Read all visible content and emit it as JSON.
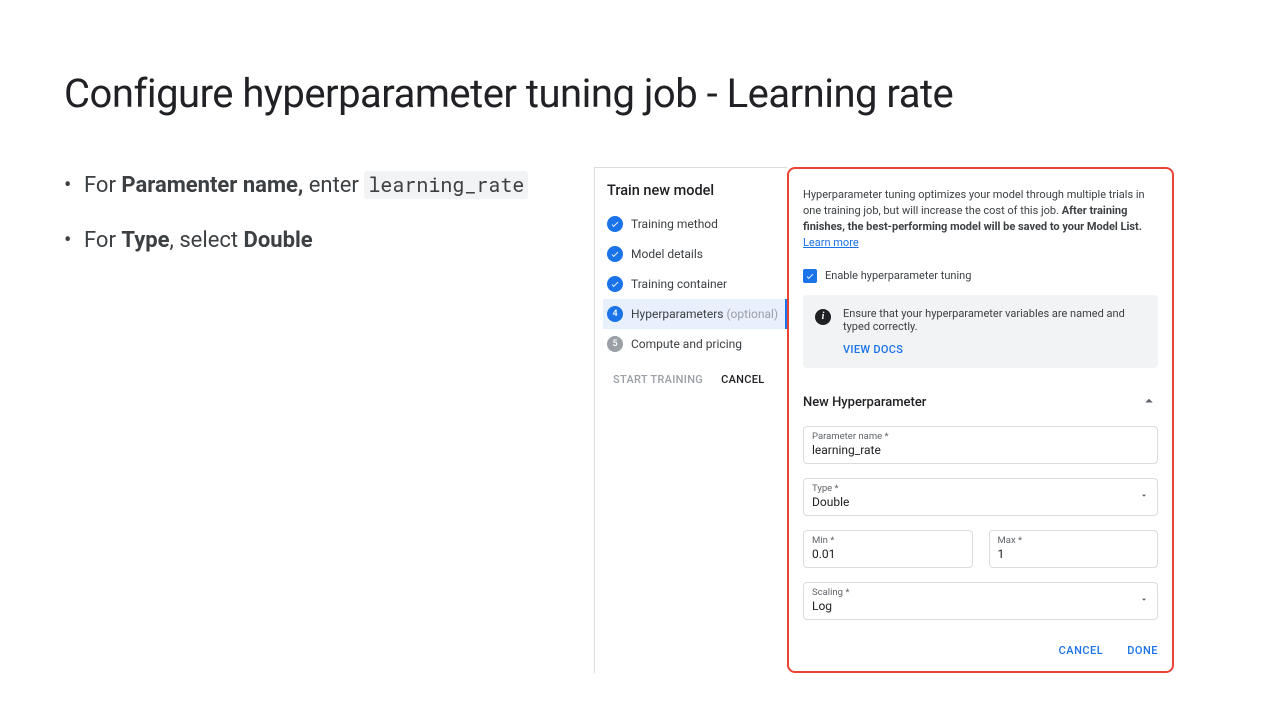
{
  "title": "Configure hyperparameter tuning job - Learning rate",
  "bullets": {
    "b1_pre": "For ",
    "b1_strong": "Paramenter name,",
    "b1_post": " enter ",
    "b1_code": "learning_rate",
    "b2_pre": "For ",
    "b2_strong1": "Type",
    "b2_mid": ", select ",
    "b2_strong2": "Double"
  },
  "stepper": {
    "heading": "Train new model",
    "steps": [
      {
        "label": "Training method"
      },
      {
        "label": "Model details"
      },
      {
        "label": "Training container"
      },
      {
        "label": "Hyperparameters",
        "suffix": "(optional)",
        "num": "4",
        "active": true
      },
      {
        "label": "Compute and pricing",
        "num": "5",
        "pending": true
      }
    ],
    "start": "START TRAINING",
    "cancel": "CANCEL"
  },
  "panel": {
    "desc_plain": "Hyperparameter tuning optimizes your model through multiple trials in one training job, but will increase the cost of this job. ",
    "desc_strong": "After training finishes, the best-performing model will be saved to your Model List.",
    "learn_more": "Learn more",
    "checkbox_label": "Enable hyperparameter tuning",
    "info_msg": "Ensure that your hyperparameter variables are named and typed correctly.",
    "view_docs": "VIEW DOCS",
    "hp_title": "New Hyperparameter",
    "fields": {
      "param_name_label": "Parameter name *",
      "param_name_value": "learning_rate",
      "type_label": "Type *",
      "type_value": "Double",
      "min_label": "Min *",
      "min_value": "0.01",
      "max_label": "Max *",
      "max_value": "1",
      "scaling_label": "Scaling *",
      "scaling_value": "Log"
    },
    "cancel": "CANCEL",
    "done": "DONE"
  }
}
